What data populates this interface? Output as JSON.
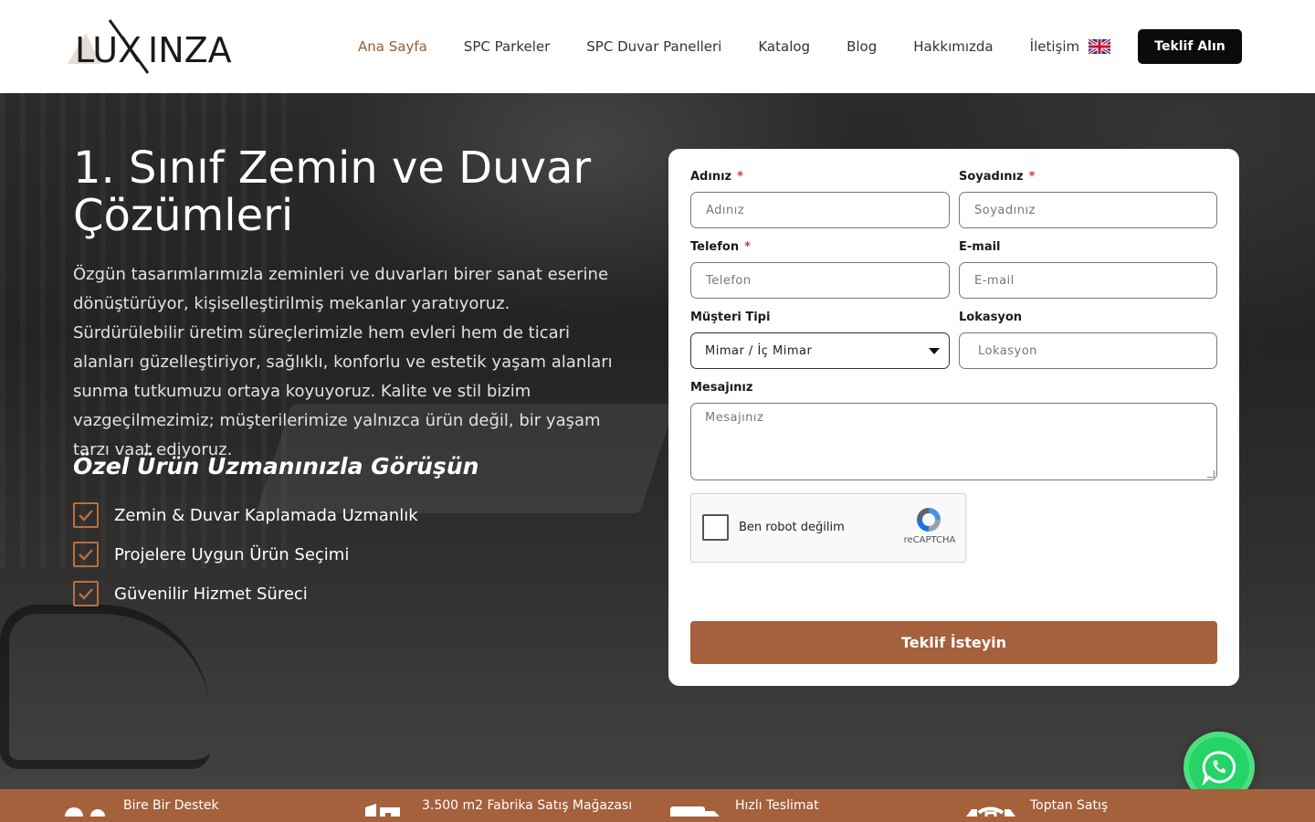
{
  "header": {
    "logo_text": "LUXINZA",
    "nav": [
      {
        "label": "Ana Sayfa",
        "active": true
      },
      {
        "label": "SPC Parkeler",
        "active": false
      },
      {
        "label": "SPC Duvar Panelleri",
        "active": false
      },
      {
        "label": "Katalog",
        "active": false
      },
      {
        "label": "Blog",
        "active": false
      },
      {
        "label": "Hakkımızda",
        "active": false
      },
      {
        "label": "İletişim",
        "active": false
      }
    ],
    "language_icon": "uk-flag-icon",
    "cta_label": "Teklif Alın"
  },
  "hero": {
    "title": "1. Sınıf Zemin ve Duvar Çözümleri",
    "text": "Özgün tasarımlarımızla zeminleri ve duvarları birer sanat eserine dönüştürüyor, kişiselleştirilmiş mekanlar yaratıyoruz. Sürdürülebilir üretim süreçlerimizle hem evleri hem de ticari alanları güzelleştiriyor, sağlıklı, konforlu ve estetik yaşam alanları sunma tutkumuzu ortaya koyuyoruz. Kalite ve stil bizim vazgeçilmezimiz; müşterilerimize yalnızca ürün değil, bir yaşam tarzı vaat ediyoruz.",
    "subtitle": "Özel Ürün Uzmanınızla Görüşün",
    "features": [
      "Zemin & Duvar Kaplamada Uzmanlık",
      "Projelere Uygun Ürün Seçimi",
      "Güvenilir Hizmet Süreci"
    ]
  },
  "form": {
    "first_name": {
      "label": "Adınız",
      "required_mark": "*",
      "placeholder": "Adınız"
    },
    "last_name": {
      "label": "Soyadınız",
      "required_mark": "*",
      "placeholder": "Soyadınız"
    },
    "phone": {
      "label": "Telefon",
      "required_mark": "*",
      "placeholder": "Telefon"
    },
    "email": {
      "label": "E-mail",
      "placeholder": "E-mail"
    },
    "customer_type": {
      "label": "Müşteri Tipi",
      "selected": "Mimar / İç Mimar"
    },
    "location": {
      "label": "Lokasyon",
      "placeholder": "Lokasyon"
    },
    "message": {
      "label": "Mesajınız",
      "placeholder": "Mesajınız"
    },
    "captcha": {
      "label": "Ben robot değilim",
      "brand": "reCAPTCHA"
    },
    "submit_label": "Teklif İsteyin"
  },
  "bottom_bar": [
    {
      "label": "Bire Bir Destek",
      "icon": "support-icon"
    },
    {
      "label": "3.500 m2 Fabrika Satış Mağazası",
      "icon": "building-icon"
    },
    {
      "label": "Hızlı Teslimat",
      "icon": "truck-icon"
    },
    {
      "label": "Toptan Satış",
      "icon": "handshake-icon"
    }
  ],
  "colors": {
    "accent": "#a5603c",
    "nav_active": "#9a5a36",
    "cta_bg": "#0b0b0b",
    "whatsapp": "#25d366"
  }
}
